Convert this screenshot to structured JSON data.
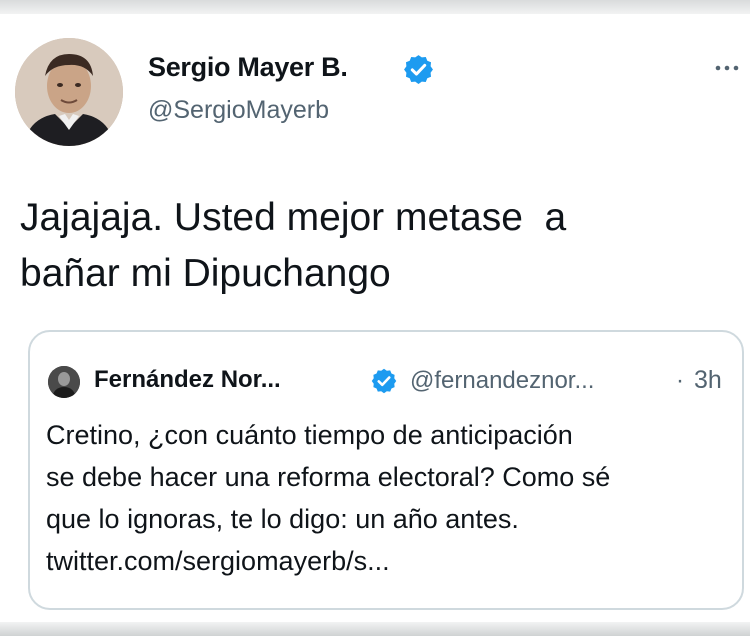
{
  "tweet": {
    "author": {
      "name": "Sergio Mayer B.",
      "handle": "@SergioMayerb",
      "verified": true
    },
    "text": "Jajajaja. Usted mejor metase  a\nbañar mi Dipuchango",
    "more_icon": "ellipsis-icon"
  },
  "quoted_tweet": {
    "author": {
      "name": "Fernández Nor...",
      "handle": "@fernandeznor...",
      "verified": true
    },
    "separator": "·",
    "time": "3h",
    "lines": [
      "Cretino, ¿con cuánto tiempo de anticipación",
      "se debe hacer una reforma electoral? Como sé",
      "que lo ignoras, te lo digo: un año antes.",
      "twitter.com/sergiomayerb/s..."
    ]
  },
  "colors": {
    "verified_blue": "#1d9bf0",
    "text_primary": "#0f1419",
    "text_secondary": "#536471",
    "card_border": "#cfd9de"
  }
}
